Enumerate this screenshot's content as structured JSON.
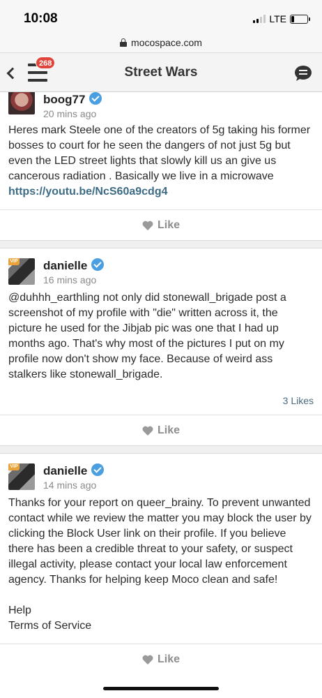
{
  "status_bar": {
    "time": "10:08",
    "network": "LTE"
  },
  "browser": {
    "url": "mocospace.com",
    "lock_icon": "lock-icon"
  },
  "header": {
    "title": "Street Wars",
    "notification_count": "268",
    "back_icon": "chevron-left-icon",
    "menu_icon": "hamburger-icon",
    "chat_icon": "chat-bubble-icon",
    "badge_color": "#e0453b"
  },
  "posts": [
    {
      "user": "boog77",
      "time": "20 mins ago",
      "text": "Heres mark Steele one of the creators of 5g taking his former bosses to court for he seen the dangers of not just 5g but even the LED street lights that slowly kill us an give us cancerous radiation . Basically we live in a microwave ",
      "link": "https://youtu.be/NcS60a9cdg4",
      "like_label": "Like"
    },
    {
      "user": "danielle",
      "vip": "VIP",
      "time": "16 mins ago",
      "text": "@duhhh_earthling not only did stonewall_brigade post a screenshot of my profile with \"die\" written across it, the picture he used for the Jibjab pic was one that I had up months ago. That's why most of the pictures I put on my profile now don't show my face. Because of weird ass stalkers like stonewall_brigade.",
      "likes": "3 Likes",
      "like_label": "Like"
    },
    {
      "user": "danielle",
      "vip": "VIP",
      "time": "14 mins ago",
      "text": "Thanks for your report on queer_brainy. To prevent unwanted contact while we review the matter you may block the user by clicking the Block User link on their profile. If you believe there has been a credible threat to your safety, or suspect illegal activity, please contact your local law enforcement agency. Thanks for helping keep Moco clean and safe!",
      "footer_line1": "Help",
      "footer_line2": "Terms of Service",
      "like_label": "Like"
    }
  ],
  "colors": {
    "verified": "#4a9fe0",
    "link": "#3c6b86",
    "like": "#8d8d8d"
  }
}
